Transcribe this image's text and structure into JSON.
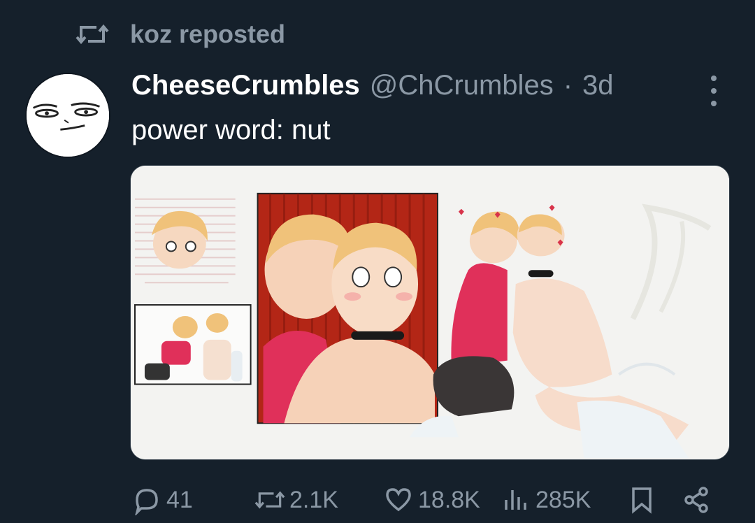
{
  "colors": {
    "background": "#15202b",
    "muted": "#8b98a5",
    "text": "#ffffff"
  },
  "repost_banner": {
    "icon": "repost-icon",
    "text": "koz reposted"
  },
  "author": {
    "display_name": "CheeseCrumbles",
    "handle": "@ChCrumbles",
    "separator": "·",
    "time": "3d",
    "avatar": "avatar-face"
  },
  "tweet": {
    "text": "power word: nut",
    "media": "comic-illustration-panels"
  },
  "actions": {
    "replies": "41",
    "reposts": "2.1K",
    "likes": "18.8K",
    "views": "285K"
  }
}
